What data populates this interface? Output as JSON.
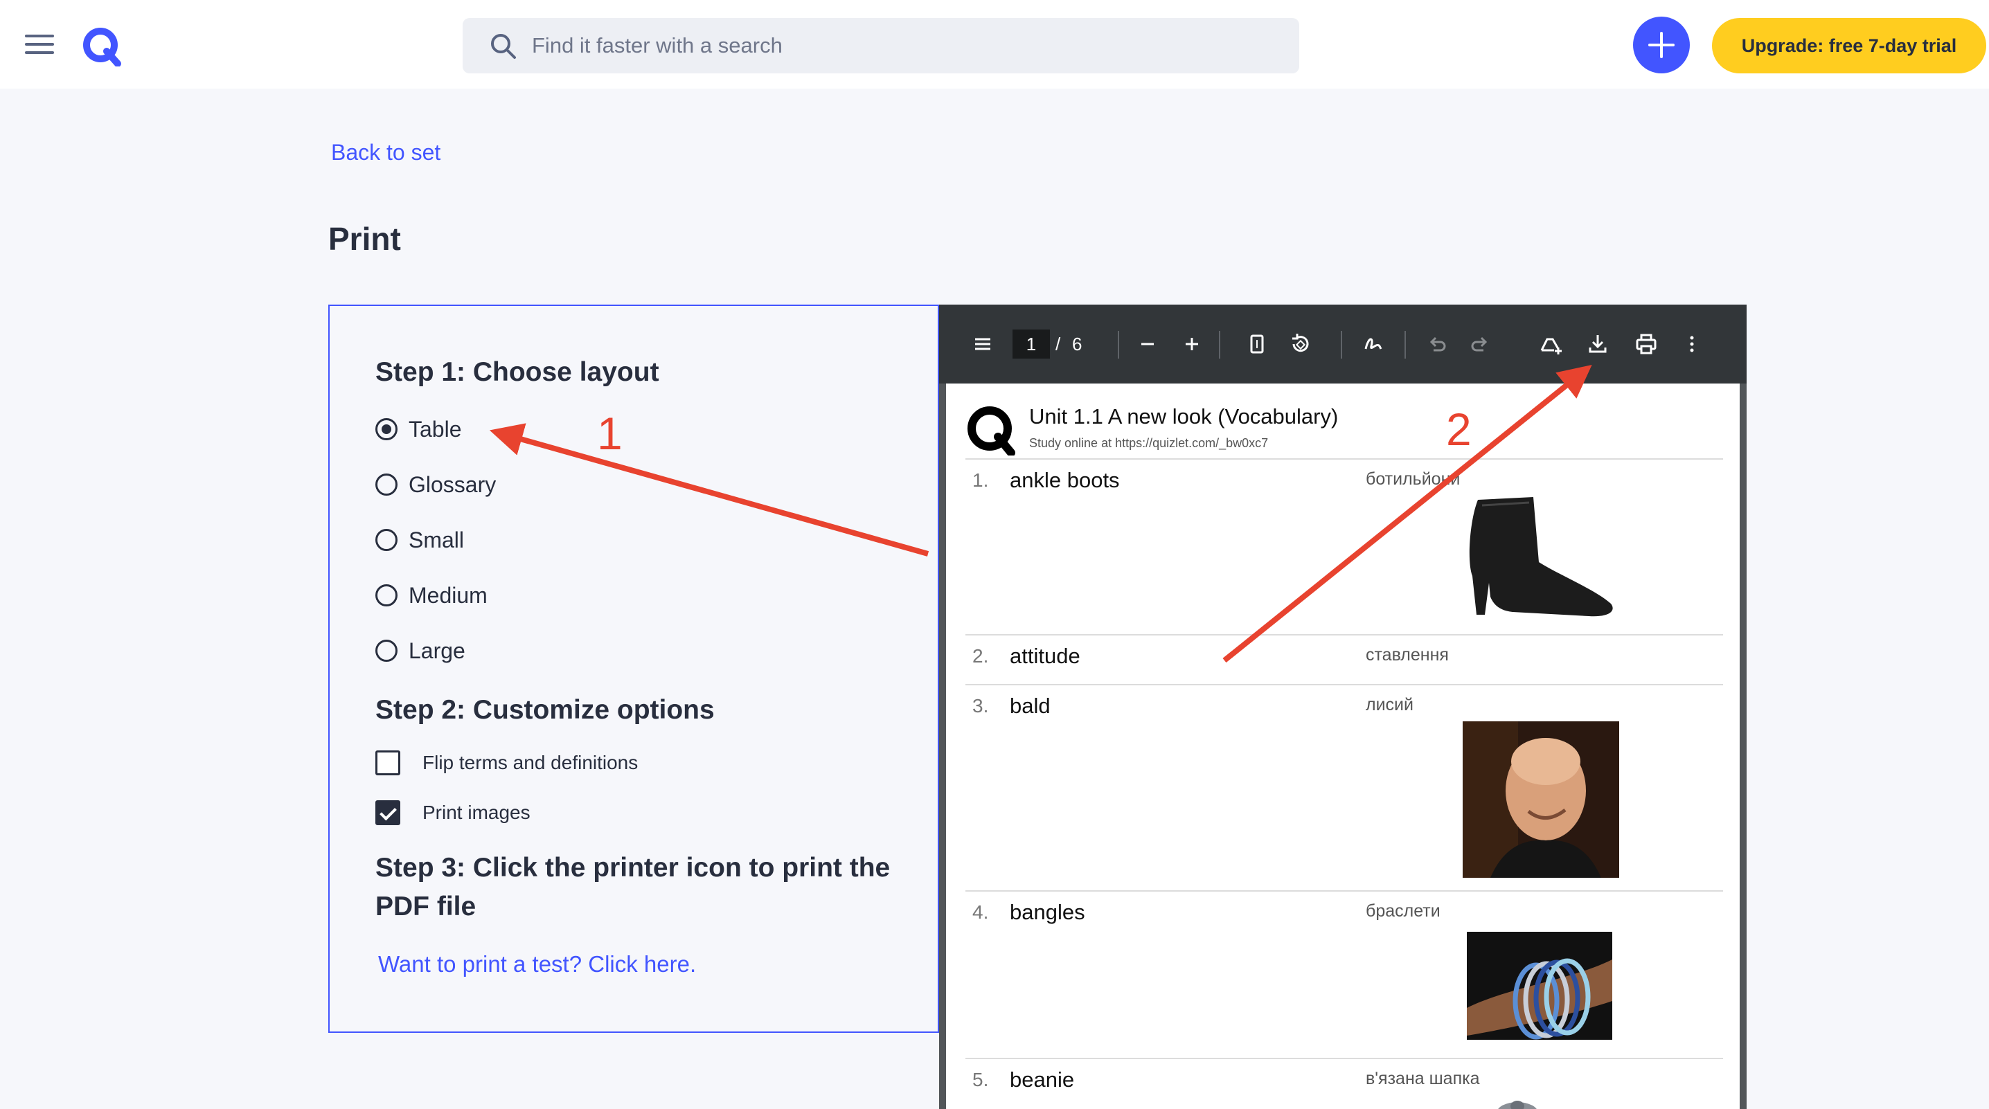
{
  "header": {
    "search_placeholder": "Find it faster with a search",
    "upgrade_label": "Upgrade: free 7-day trial"
  },
  "page": {
    "back_link": "Back to set",
    "title": "Print"
  },
  "options": {
    "step1_heading": "Step 1: Choose layout",
    "layouts": [
      {
        "label": "Table",
        "selected": true
      },
      {
        "label": "Glossary",
        "selected": false
      },
      {
        "label": "Small",
        "selected": false
      },
      {
        "label": "Medium",
        "selected": false
      },
      {
        "label": "Large",
        "selected": false
      }
    ],
    "step2_heading": "Step 2: Customize options",
    "customize": [
      {
        "label": "Flip terms and definitions",
        "checked": false
      },
      {
        "label": "Print images",
        "checked": true
      }
    ],
    "step3_heading": "Step 3: Click the printer icon to print the PDF file",
    "test_link": "Want to print a test? Click here."
  },
  "viewer": {
    "current_page": "1",
    "separator": "/",
    "total_pages": "6"
  },
  "pdf": {
    "title": "Unit 1.1 A new look (Vocabulary)",
    "subtitle": "Study online at https://quizlet.com/_bw0xc7",
    "rows": [
      {
        "num": "1.",
        "term": "ankle boots",
        "definition": "ботильйони"
      },
      {
        "num": "2.",
        "term": "attitude",
        "definition": "ставлення"
      },
      {
        "num": "3.",
        "term": "bald",
        "definition": "лисий"
      },
      {
        "num": "4.",
        "term": "bangles",
        "definition": "браслети"
      },
      {
        "num": "5.",
        "term": "beanie",
        "definition": "в'язана шапка"
      }
    ]
  },
  "annotations": {
    "label_1": "1",
    "label_2": "2",
    "color": "#e8432f"
  },
  "colors": {
    "brand_blue": "#4255ff",
    "upgrade_yellow": "#ffcd1f",
    "page_bg": "#f6f7fb",
    "viewer_toolbar": "#323639"
  }
}
